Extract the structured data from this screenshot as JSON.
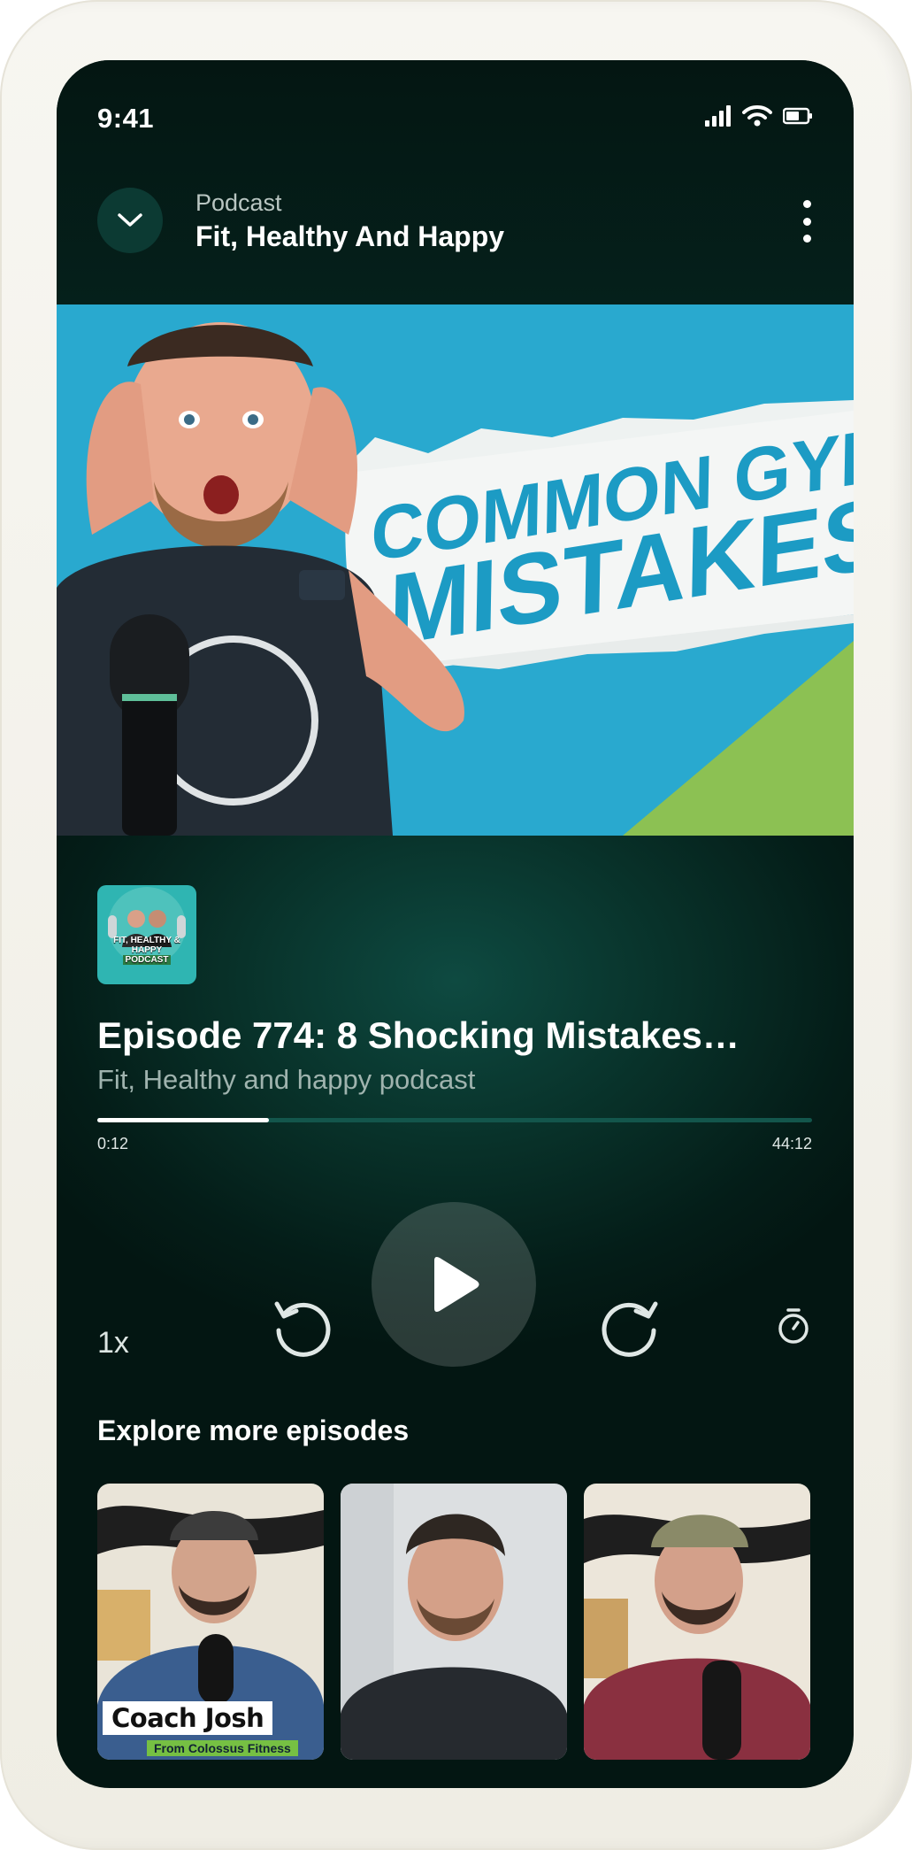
{
  "status_bar": {
    "time": "9:41"
  },
  "header": {
    "kicker": "Podcast",
    "title": "Fit, Healthy And Happy"
  },
  "hero": {
    "headline_line1": "COMMON GYM",
    "headline_line2": "MISTAKES"
  },
  "show_art": {
    "caption_line1": "FIT, HEALTHY & HAPPY",
    "caption_line2": "PODCAST"
  },
  "episode": {
    "title": "Episode 774: 8 Shocking Mistakes…",
    "show": "Fit, Healthy and happy podcast",
    "elapsed": "0:12",
    "duration": "44:12",
    "progress_fraction": 0.24
  },
  "controls": {
    "speed": "1x",
    "icons": [
      "rewind-icon",
      "play-icon",
      "forward-icon",
      "sleep-timer-icon"
    ]
  },
  "explore": {
    "title": "Explore more episodes",
    "episodes": [
      {
        "label": "Coach Josh",
        "sublabel": "From Colossus Fitness"
      },
      {
        "label": ""
      },
      {
        "label": ""
      }
    ]
  },
  "colors": {
    "background": "#041d18",
    "accent_track": "#13564c",
    "hero_blue": "#29a9cf",
    "hero_green": "#8cc153"
  }
}
